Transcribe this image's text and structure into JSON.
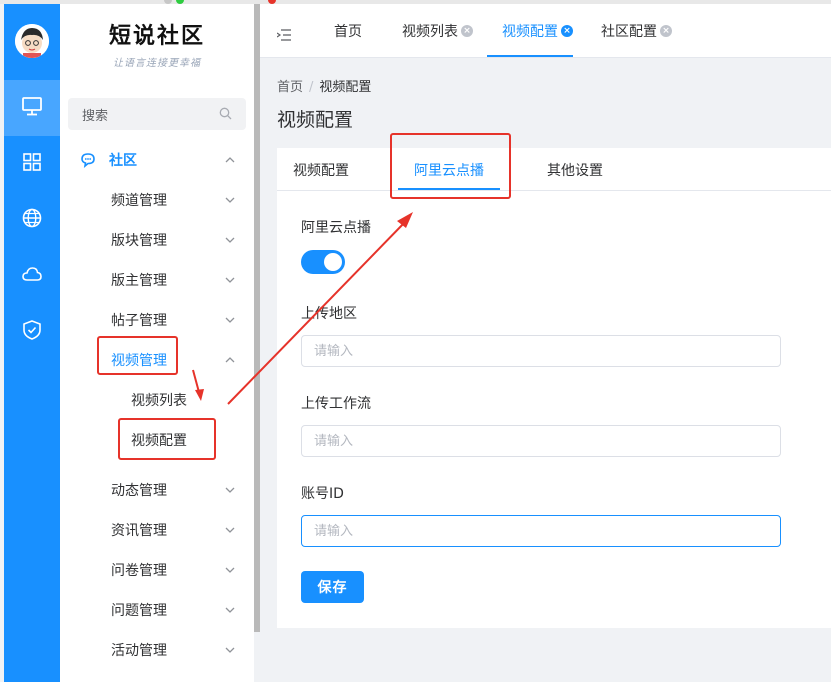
{
  "brand": {
    "title": "短说社区",
    "subtitle": "让语言连接更幸福"
  },
  "search": {
    "label": "搜索"
  },
  "sidebar": {
    "section": "社区",
    "items": [
      {
        "label": "频道管理"
      },
      {
        "label": "版块管理"
      },
      {
        "label": "版主管理"
      },
      {
        "label": "帖子管理"
      },
      {
        "label": "视频管理"
      },
      {
        "label": "动态管理"
      },
      {
        "label": "资讯管理"
      },
      {
        "label": "问卷管理"
      },
      {
        "label": "问题管理"
      },
      {
        "label": "活动管理"
      }
    ],
    "video_sub": [
      {
        "label": "视频列表"
      },
      {
        "label": "视频配置"
      }
    ]
  },
  "rail": {
    "icons": [
      "monitor-icon",
      "grid-icon",
      "globe-icon",
      "cloud-icon",
      "shield-icon"
    ]
  },
  "header": {
    "tabs": [
      {
        "label": "首页"
      },
      {
        "label": "视频列表"
      },
      {
        "label": "视频配置"
      },
      {
        "label": "社区配置"
      }
    ]
  },
  "breadcrumb": {
    "home": "首页",
    "sep": "/",
    "current": "视频配置"
  },
  "page": {
    "title": "视频配置"
  },
  "card": {
    "tabs": [
      {
        "label": "视频配置"
      },
      {
        "label": "阿里云点播"
      },
      {
        "label": "其他设置"
      }
    ],
    "fields": {
      "aliyun_label": "阿里云点播",
      "aliyun_enabled": true,
      "region_label": "上传地区",
      "workflow_label": "上传工作流",
      "account_label": "账号ID",
      "placeholder": "请输入"
    },
    "save_label": "保存"
  },
  "colors": {
    "primary": "#1890ff",
    "annotation": "#e6332a"
  }
}
